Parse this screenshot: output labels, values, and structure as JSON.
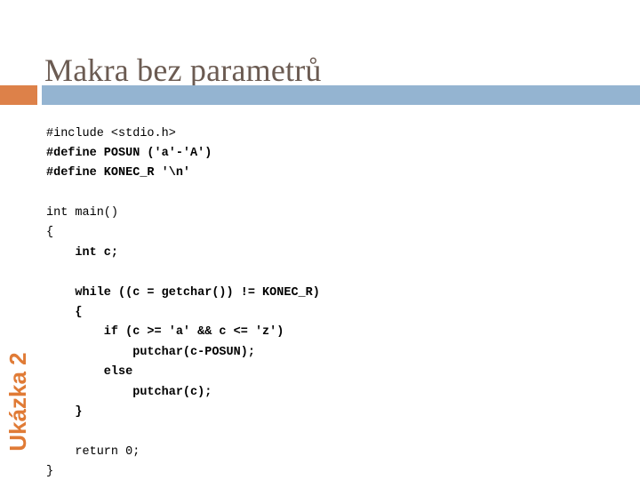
{
  "slide": {
    "title": "Makra bez parametrů",
    "side_label": "Ukázka 2",
    "colors": {
      "title_text": "#6b5b52",
      "bar_orange": "#dd8149",
      "bar_blue": "#94b4d1",
      "side_label_text": "#e07b36",
      "code_text": "#000000",
      "background": "#ffffff"
    },
    "code": {
      "language": "c",
      "lines": [
        {
          "text": "#include <stdio.h>",
          "bold": false
        },
        {
          "text": "#define POSUN ('a'-'A')",
          "bold": true
        },
        {
          "text": "#define KONEC_R '\\n'",
          "bold": true
        },
        {
          "text": "",
          "bold": false
        },
        {
          "text": "int main()",
          "bold": false
        },
        {
          "text": "{",
          "bold": false
        },
        {
          "text": "    int c;",
          "bold": true
        },
        {
          "text": "",
          "bold": false
        },
        {
          "text": "    while ((c = getchar()) != KONEC_R)",
          "bold": true
        },
        {
          "text": "    {",
          "bold": true
        },
        {
          "text": "        if (c >= 'a' && c <= 'z')",
          "bold": true
        },
        {
          "text": "            putchar(c-POSUN);",
          "bold": true
        },
        {
          "text": "        else",
          "bold": true
        },
        {
          "text": "            putchar(c);",
          "bold": true
        },
        {
          "text": "    }",
          "bold": true
        },
        {
          "text": "",
          "bold": false
        },
        {
          "text": "    return 0;",
          "bold": false
        },
        {
          "text": "}",
          "bold": false
        }
      ]
    }
  }
}
